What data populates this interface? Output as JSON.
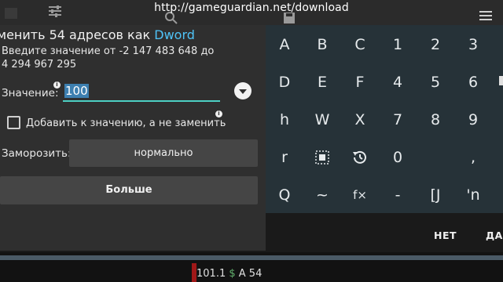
{
  "watermark": "http://gameguardian.net/download",
  "dialog": {
    "title_prefix": "менить 54 адресов как ",
    "title_type": "Dword",
    "hint_line1": "Введите значение от -2 147 483 648 до",
    "hint_line2": "4 294 967 295",
    "value_label": "Значение:",
    "value": "100",
    "checkbox_label": "Добавить к значению, а не заменить",
    "freeze_label": "Заморозить:",
    "freeze_value": "нормально",
    "more_button": "Больше",
    "cancel_button": "НЕТ",
    "ok_button": "ДА"
  },
  "keyboard": {
    "rows": [
      [
        "A",
        "B",
        "C",
        "1",
        "2",
        "3"
      ],
      [
        "D",
        "E",
        "F",
        "4",
        "5",
        "6"
      ],
      [
        "h",
        "W",
        "X",
        "7",
        "8",
        "9"
      ],
      [
        "r",
        "",
        "",
        "0",
        "",
        ","
      ],
      [
        "Q",
        "~",
        "f×",
        "-",
        "[J",
        "'n"
      ]
    ]
  },
  "status": {
    "value": "101.1",
    "currency": "$",
    "suffix": "A 54"
  },
  "colors": {
    "accent": "#4fc3f7",
    "input_underline": "#4dd0c4",
    "keyboard_bg": "#263238",
    "dialog_bg": "#2f2f2f"
  }
}
